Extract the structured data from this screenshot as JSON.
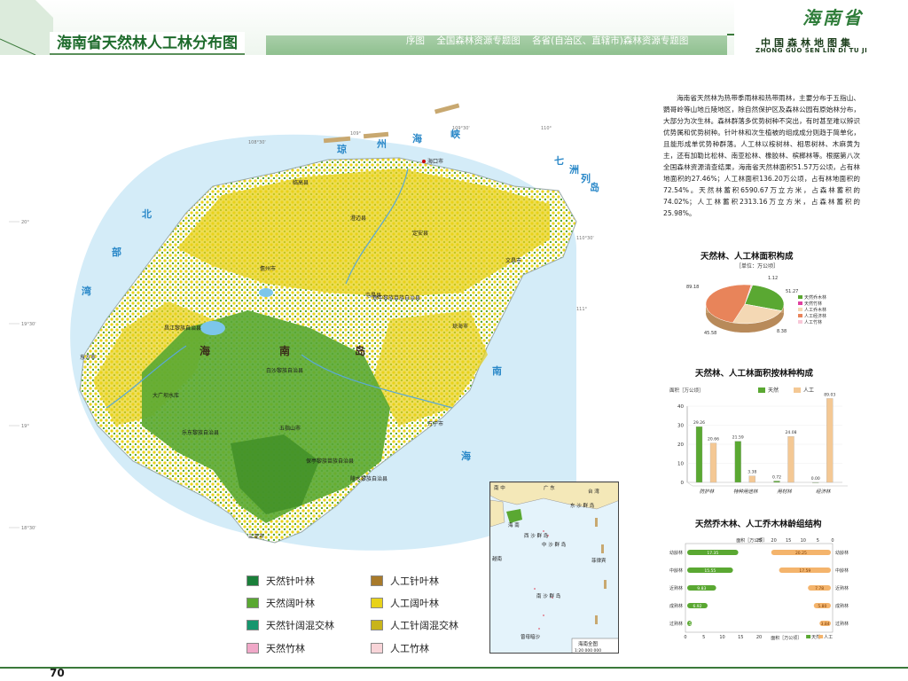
{
  "header": {
    "title": "海南省天然林人工林分布图",
    "nav": [
      "序图",
      "全国森林资源专题图",
      "各省(自治区、直辖市)森林资源专题图"
    ],
    "province": "海南省",
    "atlas_name": "中国森林地图集",
    "atlas_pinyin": "ZHONG GUO SEN LIN DI TU JI"
  },
  "page_number": "70",
  "description": "海南省天然林为热带季雨林和热带雨林，主要分布于五指山、鹦哥岭等山地丘陵地区，除自然保护区及森林公园有原始林分布，大部分为次生林。森林群落多优势树种不突出，有时甚至难以辨识优势属和优势树种。针叶林和次生植被的组成成分则趋于简单化，且能形成单优势种群落。人工林以桉树林、相思树林、木麻黄为主，还有加勒比松林、南亚松林、橡胶林、槟榔林等。根据第八次全国森林资源清查结果，海南省天然林面积51.57万公顷，占有林地面积的27.46%；人工林面积136.20万公顷，占有林地面积的72.54%。天然林蓄积6590.67万立方米，占森林蓄积的74.02%；人工林蓄积2313.16万立方米，占森林蓄积的25.98%。",
  "legend": [
    {
      "label": "天然针叶林",
      "color": "#1a7f3a"
    },
    {
      "label": "人工针叶林",
      "color": "#a87a2a"
    },
    {
      "label": "天然阔叶林",
      "color": "#5aa832"
    },
    {
      "label": "人工阔叶林",
      "color": "#e8d21a"
    },
    {
      "label": "天然针阔混交林",
      "color": "#16966e"
    },
    {
      "label": "人工针阔混交林",
      "color": "#c8b41a"
    },
    {
      "label": "天然竹林",
      "color": "#f0a8c8"
    },
    {
      "label": "人工竹林",
      "color": "#f8d4d8"
    }
  ],
  "map": {
    "sea_labels": [
      "琼",
      "州",
      "海",
      "峡",
      "北",
      "部",
      "湾",
      "南",
      "海",
      "七",
      "洲",
      "列",
      "岛"
    ],
    "island_label": [
      "海",
      "南",
      "岛"
    ],
    "places": [
      {
        "name": "海口市"
      },
      {
        "name": "澄迈县"
      },
      {
        "name": "文昌市"
      },
      {
        "name": "定安县"
      },
      {
        "name": "琼海市"
      },
      {
        "name": "万宁市"
      },
      {
        "name": "陵水黎族自治县"
      },
      {
        "name": "三亚市"
      },
      {
        "name": "乐东黎族自治县"
      },
      {
        "name": "东方市"
      },
      {
        "name": "昌江黎族自治县"
      },
      {
        "name": "儋州市"
      },
      {
        "name": "白沙黎族自治县"
      },
      {
        "name": "琼中黎族苗族自治县"
      },
      {
        "name": "五指山市"
      },
      {
        "name": "保亭黎族苗族自治县"
      },
      {
        "name": "屯昌县"
      },
      {
        "name": "临高县"
      },
      {
        "name": "大广坝水库"
      }
    ],
    "grid_labels_top": [
      "108°30'",
      "109°",
      "109°30'",
      "110°",
      "110°30'",
      "111°"
    ],
    "grid_labels_left": [
      "20°",
      "19°30'",
      "19°",
      "18°30'"
    ],
    "inset": {
      "title": "海南全图",
      "scale": "1:20 000 000",
      "labels": [
        "南 中",
        "广 东",
        "海 南",
        "台 湾",
        "西 沙 群 岛",
        "中 沙 群 岛",
        "东 沙 群 岛",
        "南 沙 群 岛",
        "曾母暗沙",
        "越南",
        "菲律宾"
      ]
    }
  },
  "chart_data": [
    {
      "type": "pie",
      "title": "天然林、人工林面积构成",
      "unit": "［单位：万公顷］",
      "categories": [
        "天然乔木林",
        "天然竹林",
        "人工乔木林",
        "人工经济林",
        "人工竹林"
      ],
      "values": [
        51.27,
        0.3,
        45.58,
        89.18,
        1.12
      ],
      "labels": [
        "1.12",
        "51.27",
        "8.38",
        "45.58",
        "89.18"
      ]
    },
    {
      "type": "bar",
      "title": "天然林、人工林面积按林种构成",
      "ylabel": "面积［万公顷］",
      "ylim": [
        0,
        40
      ],
      "yticks": [
        0,
        10,
        20,
        30,
        40
      ],
      "categories": [
        "防护林",
        "特种用途林",
        "用材林",
        "经济林"
      ],
      "series": [
        {
          "name": "天然",
          "color": "#5aa832",
          "values": [
            29.26,
            21.59,
            0.72,
            0.0
          ]
        },
        {
          "name": "人工",
          "color": "#f4c894",
          "values": [
            20.66,
            3.38,
            24.08,
            89.03
          ]
        }
      ],
      "labels_natural": [
        "29.26",
        "21.59",
        "0.72",
        "0.00"
      ],
      "labels_planted": [
        "20.66",
        "3.38",
        "24.08",
        "89.03"
      ]
    },
    {
      "type": "bar",
      "title": "天然乔木林、人工乔木林龄组结构",
      "xlabel": "面积［万公顷］",
      "axis_ticks_top": [
        "25",
        "20",
        "15",
        "10",
        "5",
        "0"
      ],
      "axis_ticks_bottom": [
        "0",
        "5",
        "10",
        "15",
        "20"
      ],
      "categories": [
        "幼龄林",
        "中龄林",
        "近熟林",
        "成熟林",
        "过熟林"
      ],
      "series": [
        {
          "name": "天然",
          "color": "#5aa832",
          "values": [
            17.35,
            15.55,
            9.83,
            6.92,
            1.55
          ]
        },
        {
          "name": "人工",
          "color": "#f4b46c",
          "values": [
            20.25,
            17.59,
            7.78,
            5.8,
            3.84
          ]
        }
      ]
    }
  ]
}
